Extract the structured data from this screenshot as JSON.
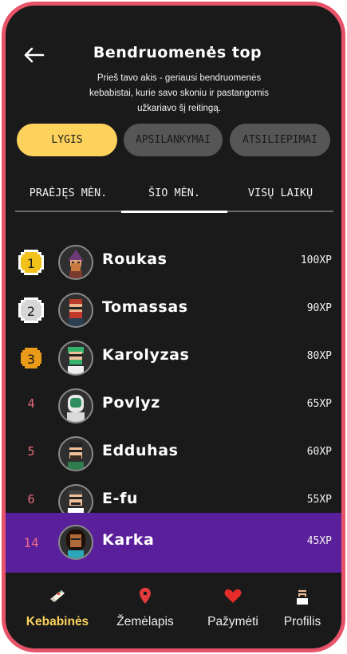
{
  "header": {
    "title": "Bendruomenės top",
    "subtitle": "Prieš tavo akis - geriausi bendruomenės kebabistai, kurie savo skoniu ir pastangomis užkariavo šį reitingą."
  },
  "segments": [
    "LYGIS",
    "APSILANKYMAI",
    "ATSILIEPIMAI"
  ],
  "tabs": [
    "PRAĖJĘS MĖN.",
    "ŠIO MĖN.",
    "VISŲ LAIKŲ"
  ],
  "leaderboard": [
    {
      "rank": "1",
      "name": "Roukas",
      "xp": "100XP"
    },
    {
      "rank": "2",
      "name": "Tomassas",
      "xp": "90XP"
    },
    {
      "rank": "3",
      "name": "Karolyzas",
      "xp": "80XP"
    },
    {
      "rank": "4",
      "name": "Povlyz",
      "xp": "65XP"
    },
    {
      "rank": "5",
      "name": "Edduhas",
      "xp": "60XP"
    },
    {
      "rank": "6",
      "name": "E-fu",
      "xp": "55XP"
    }
  ],
  "current_user": {
    "rank": "14",
    "name": "Karka",
    "xp": "45XP"
  },
  "nav": [
    "Kebabinės",
    "Žemėlapis",
    "Pažymėti",
    "Profilis"
  ],
  "colors": {
    "accent": "#fcd25c",
    "frame": "#e8536a",
    "highlight_row": "#5a1f9a",
    "gold": "#f2c21a",
    "silver": "#d6d6d6",
    "bronze": "#e99a18"
  }
}
